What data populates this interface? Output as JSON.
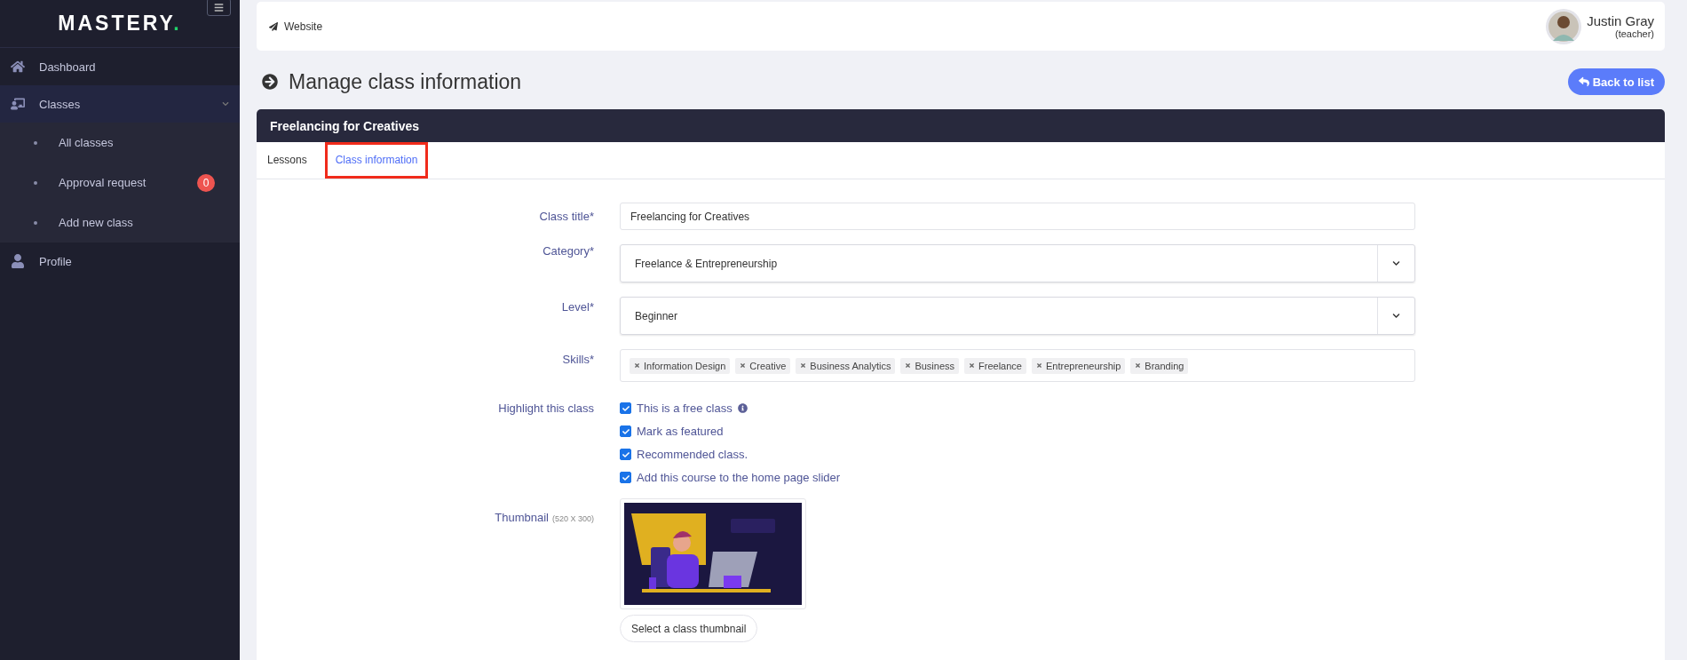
{
  "sidebar": {
    "logo": "MASTERY",
    "logo_dot": ".",
    "items": [
      {
        "kind": "link",
        "label": "Dashboard",
        "selected": false
      },
      {
        "kind": "group",
        "label": "Classes",
        "selected": true,
        "expanded": true,
        "children": [
          {
            "label": "All classes"
          },
          {
            "label": "Approval request",
            "badge": "0"
          },
          {
            "label": "Add new class"
          }
        ]
      },
      {
        "kind": "link",
        "label": "Profile",
        "selected": false
      }
    ]
  },
  "topbar": {
    "website_link": "Website",
    "user": {
      "name": "Justin Gray",
      "role": "(teacher)"
    }
  },
  "page": {
    "title": "Manage class information",
    "back_button": "Back to list"
  },
  "card": {
    "title": "Freelancing for Creatives",
    "tabs": [
      {
        "label": "Lessons",
        "selected": false,
        "highlighted": false
      },
      {
        "label": "Class information",
        "selected": true,
        "highlighted": true
      }
    ],
    "form": {
      "class_title": {
        "label": "Class title*",
        "value": "Freelancing for Creatives"
      },
      "category": {
        "label": "Category*",
        "value": "Freelance & Entrepreneurship"
      },
      "level": {
        "label": "Level*",
        "value": "Beginner"
      },
      "skills": {
        "label": "Skills*",
        "tags": [
          "Information Design",
          "Creative",
          "Business Analytics",
          "Business",
          "Freelance",
          "Entrepreneurship",
          "Branding"
        ]
      },
      "highlight": {
        "label": "Highlight this class",
        "options": [
          {
            "label": "This is a free class",
            "checked": true,
            "info": true
          },
          {
            "label": "Mark as featured",
            "checked": true,
            "info": false
          },
          {
            "label": "Recommended class.",
            "checked": true,
            "info": false
          },
          {
            "label": "Add this course to the home page slider",
            "checked": true,
            "info": false
          }
        ]
      },
      "thumbnail": {
        "label": "Thumbnail",
        "hint": "(520 X 300)",
        "button": "Select a class thumbnail"
      }
    }
  }
}
